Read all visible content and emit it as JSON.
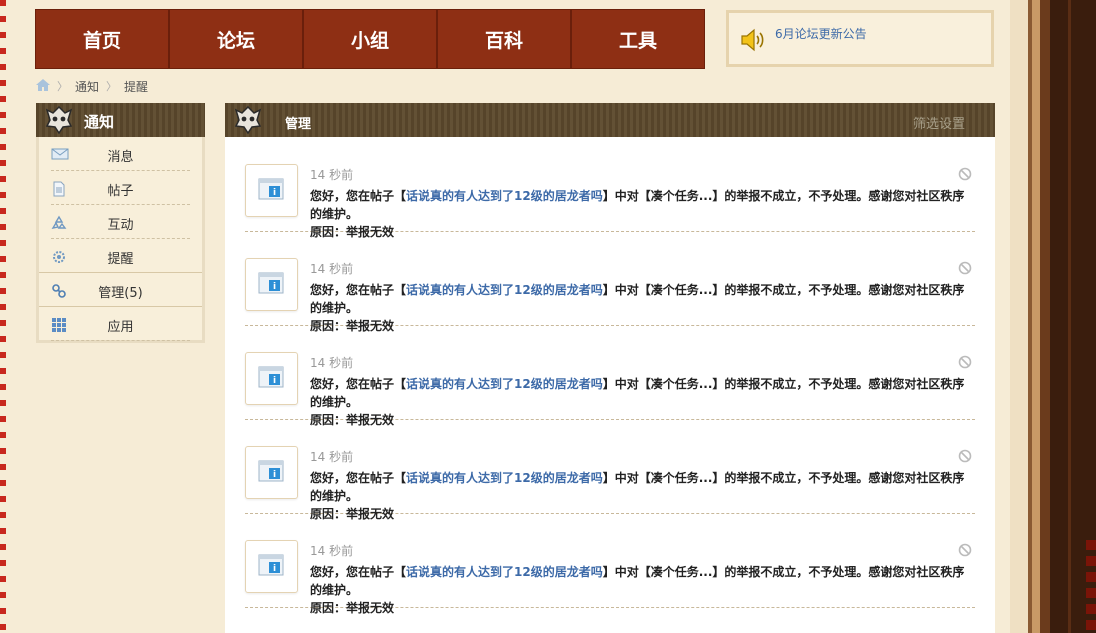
{
  "nav": {
    "items": [
      "首页",
      "论坛",
      "小组",
      "百科",
      "工具"
    ]
  },
  "notice": {
    "text": "6月论坛更新公告"
  },
  "breadcrumb": {
    "items": [
      "通知",
      "提醒"
    ]
  },
  "sidebar": {
    "title": "通知",
    "items": [
      {
        "label": "消息",
        "icon": "envelope-icon"
      },
      {
        "label": "帖子",
        "icon": "document-icon"
      },
      {
        "label": "互动",
        "icon": "recycle-icon"
      },
      {
        "label": "提醒",
        "icon": "gear-icon"
      },
      {
        "label": "管理(5)",
        "icon": "link-icon"
      },
      {
        "label": "应用",
        "icon": "grid-icon"
      }
    ]
  },
  "main": {
    "title": "管理",
    "filter_label": "筛选设置",
    "notifications": [
      {
        "time": "14 秒前",
        "prefix": "您好，您在帖子【",
        "link": "话说真的有人达到了12级的居龙者吗",
        "mid": "】中对【凑个任务...】的举报不成立，不予处理。感谢您对社区秩序的维护。",
        "reason": "原因：举报无效"
      },
      {
        "time": "14 秒前",
        "prefix": "您好，您在帖子【",
        "link": "话说真的有人达到了12级的居龙者吗",
        "mid": "】中对【凑个任务...】的举报不成立，不予处理。感谢您对社区秩序的维护。",
        "reason": "原因：举报无效"
      },
      {
        "time": "14 秒前",
        "prefix": "您好，您在帖子【",
        "link": "话说真的有人达到了12级的居龙者吗",
        "mid": "】中对【凑个任务...】的举报不成立，不予处理。感谢您对社区秩序的维护。",
        "reason": "原因：举报无效"
      },
      {
        "time": "14 秒前",
        "prefix": "您好，您在帖子【",
        "link": "话说真的有人达到了12级的居龙者吗",
        "mid": "】中对【凑个任务...】的举报不成立，不予处理。感谢您对社区秩序的维护。",
        "reason": "原因：举报无效"
      },
      {
        "time": "14 秒前",
        "prefix": "您好，您在帖子【",
        "link": "话说真的有人达到了12级的居龙者吗",
        "mid": "】中对【凑个任务...】的举报不成立，不予处理。感谢您对社区秩序的维护。",
        "reason": "原因：举报无效"
      }
    ]
  },
  "colors": {
    "nav_bg": "#8e2f14",
    "header_bg": "#5d4a2d",
    "link": "#3d6aa8",
    "page_bg": "#f6ecd6"
  }
}
